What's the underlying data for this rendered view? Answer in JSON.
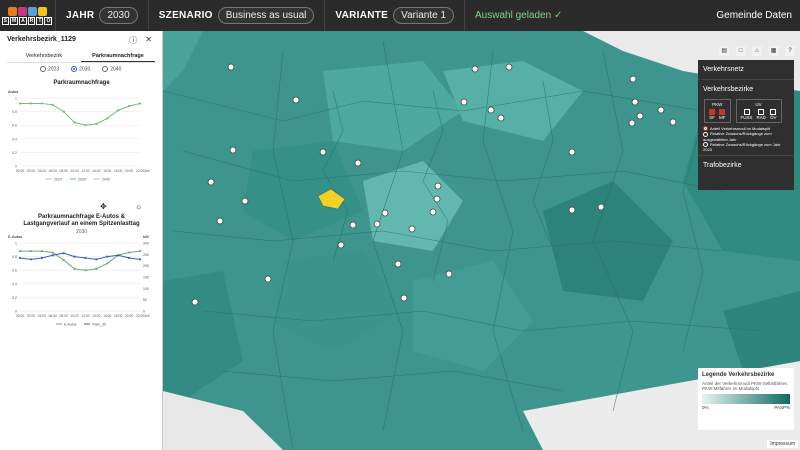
{
  "app": {
    "logo_letters": [
      "S",
      "M",
      "A",
      "R",
      "T",
      "O"
    ]
  },
  "header": {
    "jahr_label": "JAHR",
    "jahr_value": "2030",
    "szenario_label": "SZENARIO",
    "szenario_value": "Business as usual",
    "variante_label": "VARIANTE",
    "variante_value": "Variante 1",
    "status": "Auswahl geladen ✓",
    "gemeinde": "Gemeinde Daten"
  },
  "sidebar": {
    "title": "Verkehrsbezirk_1129",
    "tabs": [
      "Verkehrsbezirk",
      "Parkraumnachfrage"
    ],
    "years": [
      "2023",
      "2030",
      "2040"
    ],
    "selected_year": "2030",
    "chart1_title": "Parkraumnachfrage",
    "chart2_title": "Parkraumnachfrage E-Autos & Lastgangverlauf an einem Spitzenlasttag",
    "chart2_sub": "2030"
  },
  "chart_data": [
    {
      "type": "line",
      "title": "Parkraumnachfrage",
      "ylabel": "Autos",
      "ylim": [
        0,
        1
      ],
      "x": [
        "00:00",
        "02:00",
        "04:00",
        "06:00",
        "08:00",
        "10:00",
        "12:00",
        "14:00",
        "16:00",
        "18:00",
        "20:00",
        "22:00"
      ],
      "xlabel": "Zeit",
      "series": [
        {
          "name": "2030",
          "values": [
            0.92,
            0.92,
            0.92,
            0.9,
            0.8,
            0.64,
            0.6,
            0.62,
            0.7,
            0.82,
            0.88,
            0.92
          ]
        }
      ],
      "legend": [
        "2023",
        "2030",
        "2040"
      ]
    },
    {
      "type": "line",
      "title": "Parkraumnachfrage E-Autos & Lastgangverlauf an einem Spitzenlasttag",
      "ylabel": "E-Autos",
      "ylabel_right": "kW",
      "ylim": [
        0,
        1
      ],
      "ylim_right": [
        0,
        300
      ],
      "x": [
        "00:00",
        "02:00",
        "04:00",
        "06:00",
        "08:00",
        "10:00",
        "12:00",
        "14:00",
        "16:00",
        "18:00",
        "20:00",
        "22:00"
      ],
      "xlabel": "Zeit",
      "series": [
        {
          "name": "E-Autos",
          "values": [
            0.88,
            0.88,
            0.88,
            0.86,
            0.75,
            0.62,
            0.6,
            0.62,
            0.7,
            0.82,
            0.86,
            0.88
          ]
        },
        {
          "name": "Trafo_35",
          "values": [
            0.78,
            0.76,
            0.78,
            0.82,
            0.85,
            0.8,
            0.78,
            0.76,
            0.8,
            0.82,
            0.78,
            0.76
          ]
        }
      ]
    }
  ],
  "right_panel": {
    "items": [
      "Verkehrsnetz",
      "Verkehrsbezirke",
      "Trafobezirke"
    ],
    "pkw": "PKW",
    "uv": "UV",
    "pkw_boxes": [
      "SF",
      "MF"
    ],
    "uv_boxes": [
      "FUSS",
      "RAD",
      "ÖV"
    ],
    "options": [
      "Anteil Verkehrsmodi im Modalsplit",
      "Relative Zuwachs/Rückgänge zum ausgewählten Jahr",
      "Relative Zuwachs/Rückgänge zum Jahr 2023"
    ]
  },
  "legend": {
    "title": "Legende Verkehrsbezirke",
    "text": "Anteil der Verkehrsmodi PKW-Selbstfahrer, PKW-Mitfahrer im Modalsplit",
    "min": "0%",
    "max": "PASP%"
  },
  "footer": {
    "impressum": "Impressum"
  },
  "colors": {
    "map_base": "#3d958d",
    "accent_green": "#7ed38b",
    "selected": "#f2d024"
  }
}
